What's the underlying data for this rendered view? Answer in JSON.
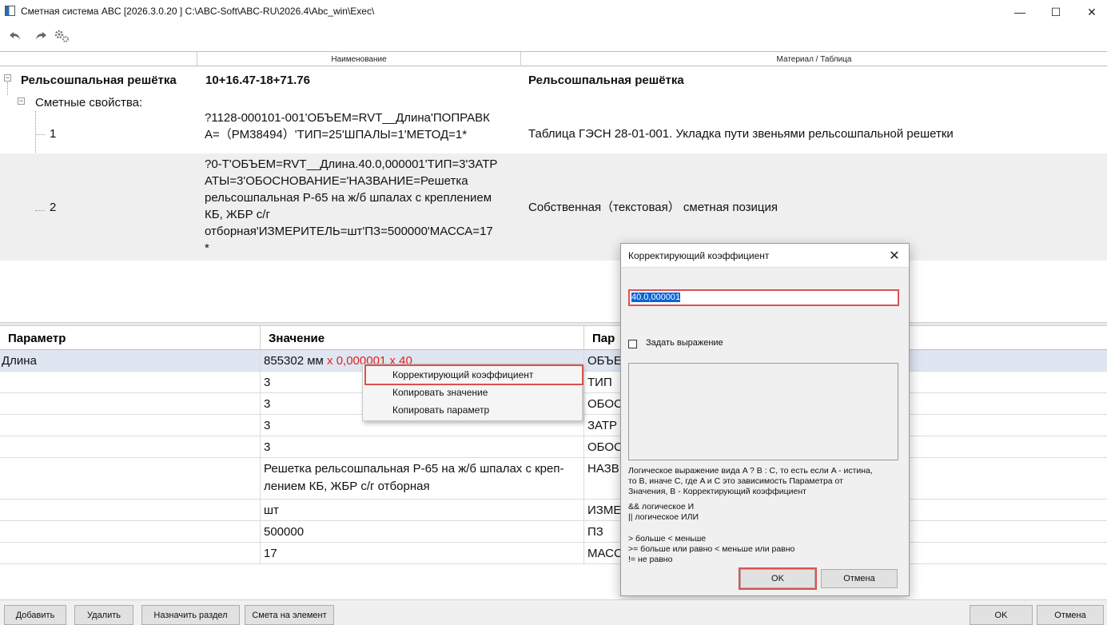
{
  "window": {
    "title": "Сметная система ABC [2026.3.0.20 ]   C:\\ABC-Soft\\ABC-RU\\2026.4\\Abc_win\\Exec\\",
    "minimize": "—",
    "maximize": "☐",
    "close": "✕"
  },
  "toolbar": {
    "icons": [
      "undo-icon",
      "redo-icon",
      "settings-icon"
    ]
  },
  "tree": {
    "headers": {
      "name": "Наименование",
      "material": "Материал / Таблица"
    },
    "root": {
      "label": "Рельсошпальная решётка",
      "name": "10+16.47-18+71.76",
      "material": "Рельсошпальная решётка"
    },
    "group_label": "Сметные свойства:",
    "items": [
      {
        "index": "1",
        "name_lines": [
          "?1128-000101-001'ОБЪЕМ=RVT__Длина'ПОПРАВК",
          "А=（РМ38494）'ТИП=25'ШПАЛЫ=1'МЕТОД=1*"
        ],
        "material": "Таблица ГЭСН 28-01-001. Укладка пути звеньями рельсошпальной решетки"
      },
      {
        "index": "2",
        "name_lines": [
          "?0-Т'ОБЪЕМ=RVT__Длина.40.0,000001'ТИП=3'ЗАТР",
          "АТЫ=3'ОБОСНОВАНИЕ='НАЗВАНИЕ=Решетка",
          "рельсошпальная Р-65 на ж/б шпалах с креплением",
          "КБ, ЖБР с/г",
          "отборная'ИЗМЕРИТЕЛЬ=шт'ПЗ=500000'МАССА=17",
          "*"
        ],
        "material": "Собственная（текстовая） сметная позиция"
      }
    ]
  },
  "grid": {
    "headers": {
      "param": "Параметр",
      "value": "Значение",
      "param2": "Пар"
    },
    "rows": [
      {
        "param": "Длина",
        "value": "855302 мм",
        "value_extra": "x 0,000001 x 40",
        "param2": "ОБЪЕ"
      },
      {
        "param": "",
        "value": "3",
        "param2": "ТИП"
      },
      {
        "param": "",
        "value": "3",
        "param2": "ОБОС"
      },
      {
        "param": "",
        "value": "3",
        "param2": "ЗАТР"
      },
      {
        "param": "",
        "value": "3",
        "param2": "ОБОС"
      },
      {
        "param": "",
        "value_lines": [
          "Решетка рельсошпальная Р-65 на ж/б шпалах с креп-",
          "лением КБ, ЖБР с/г отборная"
        ],
        "param2": "НАЗВ"
      },
      {
        "param": "",
        "value": "шт",
        "param2": "ИЗМЕ"
      },
      {
        "param": "",
        "value": "500000",
        "param2": "ПЗ"
      },
      {
        "param": "",
        "value": "17",
        "param2": "МАСС"
      }
    ]
  },
  "context_menu": {
    "items": [
      "Корректирующий коэффициент",
      "Копировать значение",
      "Копировать параметр"
    ]
  },
  "dialog": {
    "title": "Корректирующий коэффициент",
    "input_value": "40.0,000001",
    "checkbox_label": "Задать выражение",
    "help_lines": [
      "Логическое выражение вида A ? B : C, то есть если A  - истина,",
      "то B, иначе C, где A и C это зависимость Параметра от",
      "Значения, B - Корректирующий коэффициент",
      "&& логическое И",
      "|| логическое ИЛИ",
      "> больше  < меньше",
      ">= больше или равно  < меньше или равно",
      "!= не равно"
    ],
    "ok_label": "OK",
    "cancel_label": "Отмена"
  },
  "bottom_bar": {
    "add": "Добавить",
    "delete": "Удалить",
    "assign_section": "Назначить раздел",
    "estimate_for_element": "Смета на элемент",
    "ok": "OK",
    "cancel": "Отмена"
  }
}
